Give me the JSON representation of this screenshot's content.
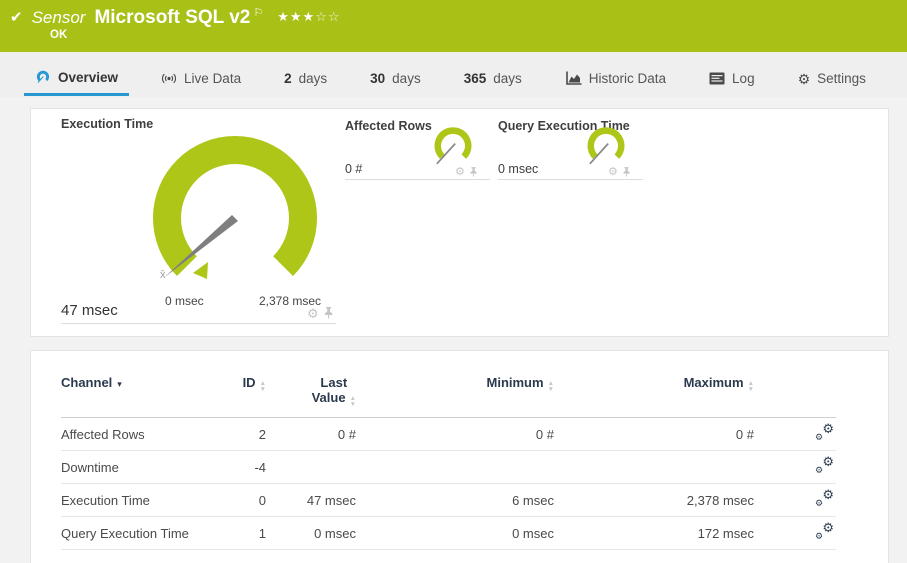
{
  "colors": {
    "status_green": "#a9c117",
    "gauge_green": "#aec618",
    "tab_accent_blue": "#2798d4"
  },
  "sensor_header": {
    "check_icon": "✔",
    "kind_label": "Sensor",
    "sensor_name": "Microsoft SQL v2",
    "flag_icon": "⚐",
    "stars_filled": "★★★",
    "stars_empty": "☆☆",
    "status": "OK"
  },
  "tabs": [
    {
      "label": "Overview"
    },
    {
      "label": "Live Data"
    },
    {
      "num": "2",
      "label": "days"
    },
    {
      "num": "30",
      "label": "days"
    },
    {
      "num": "365",
      "label": "days"
    },
    {
      "label": "Historic Data"
    },
    {
      "label": "Log"
    },
    {
      "label": "Settings"
    }
  ],
  "gauges": {
    "execution_time": {
      "title": "Execution Time",
      "value_label": "47 msec",
      "value_msec": 47,
      "min_label": "0 msec",
      "max_label": "2,378 msec",
      "min_msec": 0,
      "max_msec": 2378,
      "average_marker": "x̄"
    },
    "affected_rows": {
      "title": "Affected Rows",
      "value_label": "0 #"
    },
    "query_execution_time": {
      "title": "Query Execution Time",
      "value_label": "0 msec"
    }
  },
  "channel_table": {
    "headers": {
      "channel": "Channel",
      "id": "ID",
      "last_value_line1": "Last",
      "last_value_line2": "Value",
      "minimum": "Minimum",
      "maximum": "Maximum"
    },
    "rows": [
      {
        "channel": "Affected Rows",
        "id": "2",
        "last_value": "0 #",
        "minimum": "0 #",
        "maximum": "0 #"
      },
      {
        "channel": "Downtime",
        "id": "-4",
        "last_value": "",
        "minimum": "",
        "maximum": ""
      },
      {
        "channel": "Execution Time",
        "id": "0",
        "last_value": "47 msec",
        "minimum": "6 msec",
        "maximum": "2,378 msec"
      },
      {
        "channel": "Query Execution Time",
        "id": "1",
        "last_value": "0 msec",
        "minimum": "0 msec",
        "maximum": "172 msec"
      }
    ]
  }
}
